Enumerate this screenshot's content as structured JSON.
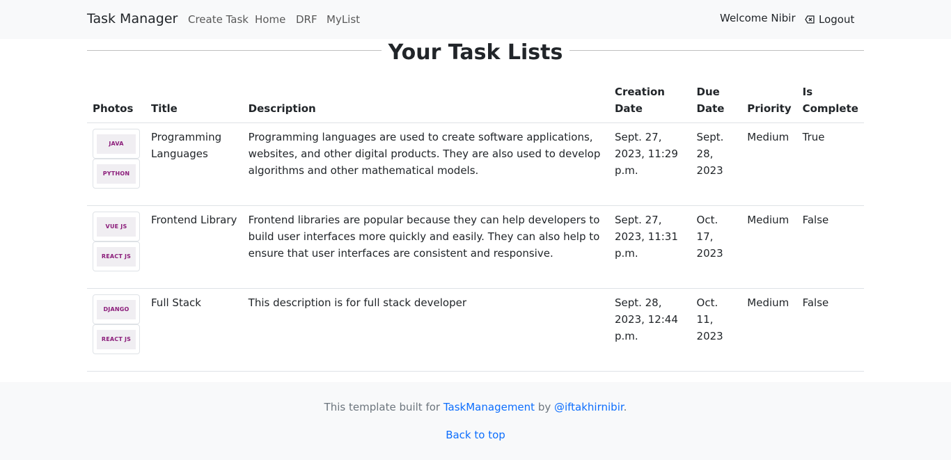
{
  "navbar": {
    "brand": "Task Manager",
    "links": [
      "Create Task",
      "Home",
      "DRF",
      "MyList"
    ],
    "welcome": "Welcome Nibir",
    "logout": "Logout"
  },
  "page": {
    "title": "Your Task Lists"
  },
  "table": {
    "headers": [
      "Photos",
      "Title",
      "Description",
      "Creation Date",
      "Due Date",
      "Priority",
      "Is Complete"
    ],
    "rows": [
      {
        "photos": [
          "JAVA",
          "PYTHON"
        ],
        "title": "Programming Languages",
        "description": "Programming languages are used to create software applications, websites, and other digital products. They are also used to develop algorithms and other mathematical models.",
        "creation_date": "Sept. 27, 2023, 11:29 p.m.",
        "due_date": "Sept. 28, 2023",
        "priority": "Medium",
        "is_complete": "True"
      },
      {
        "photos": [
          "VUE JS",
          "REACT JS"
        ],
        "title": "Frontend Library",
        "description": "Frontend libraries are popular because they can help developers to build user interfaces more quickly and easily. They can also help to ensure that user interfaces are consistent and responsive.",
        "creation_date": "Sept. 27, 2023, 11:31 p.m.",
        "due_date": "Oct. 17, 2023",
        "priority": "Medium",
        "is_complete": "False"
      },
      {
        "photos": [
          "DJANGO",
          "REACT JS"
        ],
        "title": "Full Stack",
        "description": "This description is for full stack developer",
        "creation_date": "Sept. 28, 2023, 12:44 p.m.",
        "due_date": "Oct. 11, 2023",
        "priority": "Medium",
        "is_complete": "False"
      }
    ]
  },
  "footer": {
    "text_before": "This template built for ",
    "project_link": "TaskManagement",
    "text_middle": " by ",
    "author_link": "@iftakhirnibir",
    "text_after": ".",
    "back_to_top": "Back to top"
  }
}
